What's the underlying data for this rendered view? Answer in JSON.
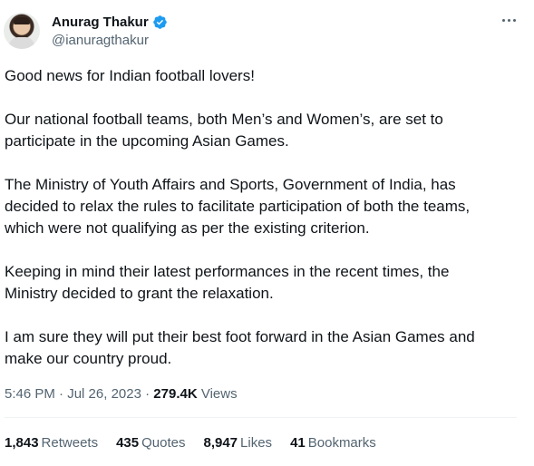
{
  "author": {
    "display_name": "Anurag Thakur",
    "handle": "@ianuragthakur"
  },
  "tweet": {
    "paragraphs": [
      "Good news for Indian football lovers!",
      "Our national football teams, both Men’s and Women’s, are set to\nparticipate in the upcoming Asian Games.",
      "The Ministry of Youth Affairs and Sports, Government of India, has\ndecided to relax the rules to facilitate participation of both the teams,\nwhich were not qualifying as per the existing criterion.",
      "Keeping in mind their latest performances in the recent times, the\nMinistry decided to grant the relaxation.",
      "I am sure they will put their best foot forward in the Asian Games and\nmake our country proud."
    ],
    "time": "5:46 PM",
    "separator": "·",
    "date": "Jul 26, 2023",
    "views_count": "279.4K",
    "views_label": "Views"
  },
  "stats": {
    "retweets_count": "1,843",
    "retweets_label": "Retweets",
    "quotes_count": "435",
    "quotes_label": "Quotes",
    "likes_count": "8,947",
    "likes_label": "Likes",
    "bookmarks_count": "41",
    "bookmarks_label": "Bookmarks"
  },
  "colors": {
    "verified": "#1d9bf0",
    "text_primary": "#0f1419",
    "text_secondary": "#536471"
  },
  "icons": {
    "verified": "verified-badge-icon",
    "more": "more-options-icon"
  }
}
